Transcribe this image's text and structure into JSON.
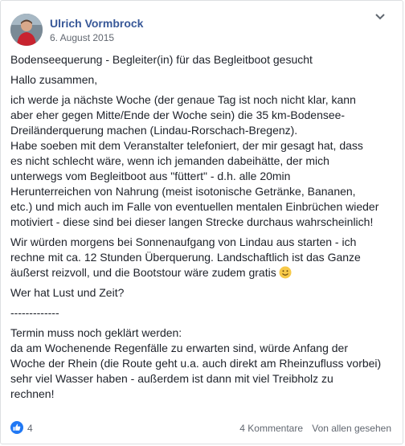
{
  "post": {
    "author": "Ulrich Vormbrock",
    "date": "6. August 2015",
    "title": "Bodenseequerung - Begleiter(in) für das Begleitboot gesucht",
    "greeting": "Hallo zusammen,",
    "paragraph1": [
      "ich werde ja nächste Woche (der genaue Tag ist noch nicht klar, kann",
      "aber eher gegen Mitte/Ende der Woche sein) die 35 km-Bodensee-",
      "Dreiländerquerung machen (Lindau-Rorschach-Bregenz).",
      "Habe soeben mit dem Veranstalter telefoniert, der mir gesagt hat, dass",
      "es nicht schlecht wäre, wenn ich jemanden dabeihätte, der mich",
      "unterwegs vom Begleitboot aus \"füttert\" - d.h. alle 20min",
      "Herunterreichen von Nahrung (meist isotonische Getränke, Bananen,",
      "etc.) und mich auch im Falle von eventuellen mentalen Einbrüchen wieder",
      "motiviert - diese sind bei dieser langen Strecke durchaus wahrscheinlich!"
    ],
    "paragraph2": [
      "Wir würden morgens bei Sonnenaufgang von Lindau aus starten - ich",
      "rechne mit ca. 12 Stunden Überquerung. Landschaftlich ist das Ganze",
      "äußerst reizvoll, und die Bootstour wäre zudem gratis"
    ],
    "question": "Wer hat Lust und Zeit?",
    "separator": "-------------",
    "paragraph3": [
      "Termin muss noch geklärt werden:",
      "da am Wochenende Regenfälle zu erwarten sind, würde Anfang der",
      "Woche der Rhein (die Route geht u.a. auch direkt am Rheinzufluss vorbei)",
      "sehr viel Wasser haben - außerdem ist dann mit viel Treibholz zu",
      "rechnen!"
    ]
  },
  "footer": {
    "like_count": "4",
    "comments": "4 Kommentare",
    "seen": "Von allen gesehen"
  },
  "icons": {
    "like": "thumbs-up-icon",
    "menu": "chevron-down-icon",
    "emoji": "smiley-icon"
  },
  "colors": {
    "author_link": "#385898",
    "like_blue": "#2078f4",
    "meta_gray": "#616770"
  }
}
